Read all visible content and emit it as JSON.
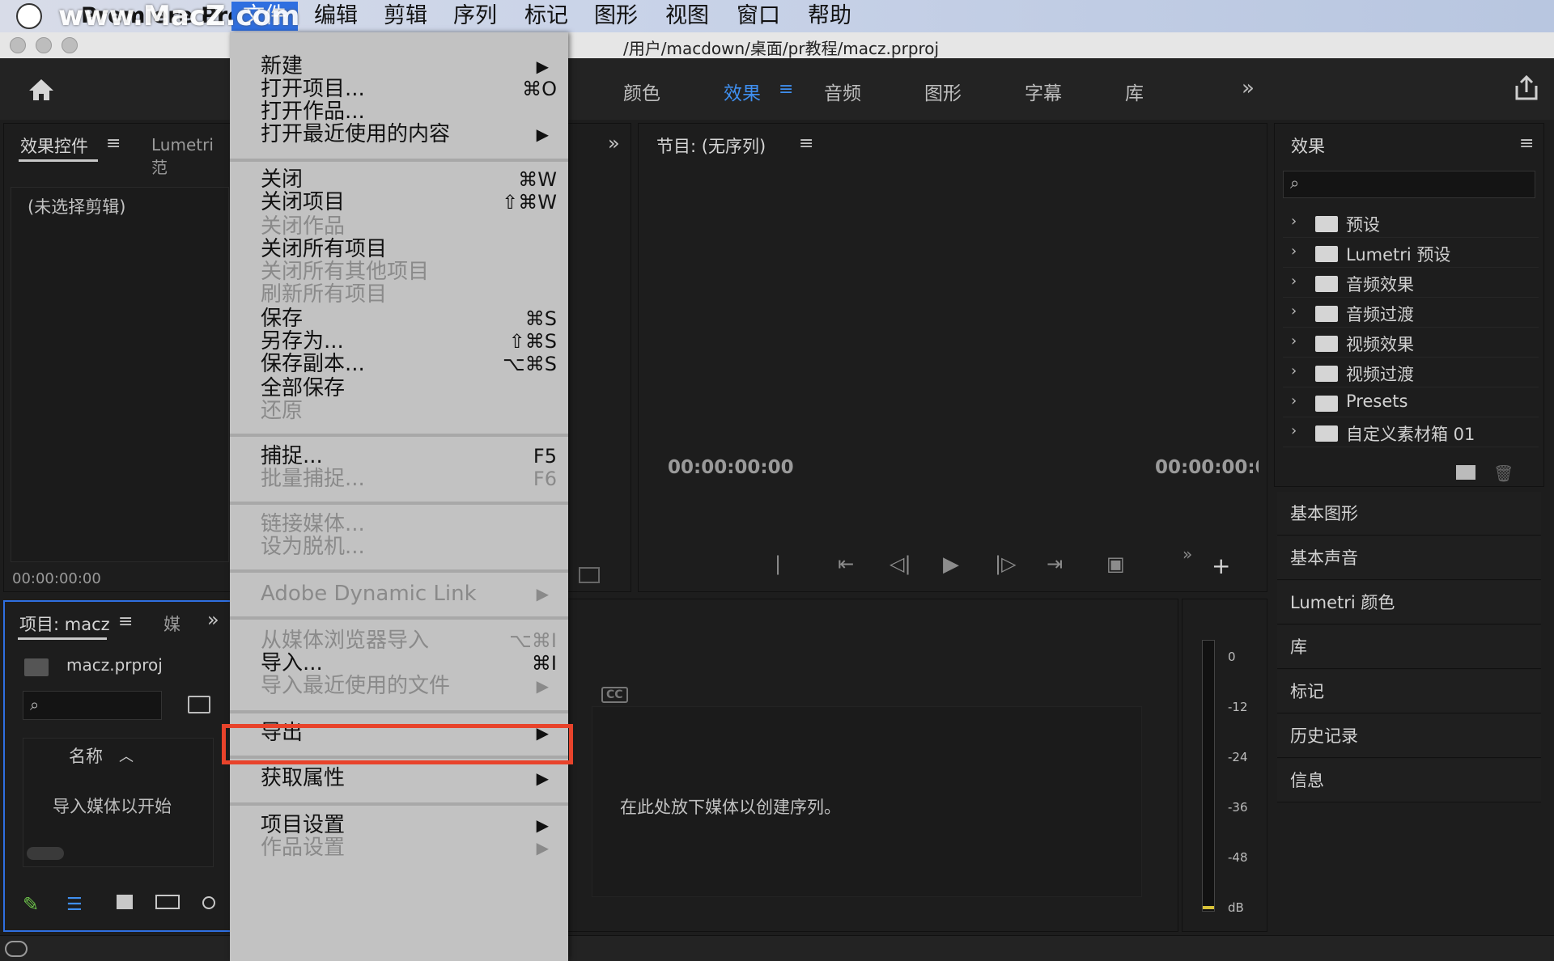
{
  "menubar": {
    "app_name": "Premiere Pro",
    "watermark": "www.MacZ.com",
    "items": [
      "文件",
      "编辑",
      "剪辑",
      "序列",
      "标记",
      "图形",
      "视图",
      "窗口",
      "帮助"
    ]
  },
  "window": {
    "title_path": "/用户/macdown/桌面/pr教程/macz.prproj"
  },
  "workspaces": {
    "tabs": [
      "颜色",
      "效果",
      "音频",
      "图形",
      "字幕",
      "库"
    ],
    "active": "效果"
  },
  "effect_controls": {
    "tab": "效果控件",
    "tab2": "Lumetri 范",
    "no_clip": "(未选择剪辑)",
    "timecode": "00:00:00:00"
  },
  "project": {
    "tab": "项目: macz",
    "tab2": "媒",
    "file": "macz.prproj",
    "col_name": "名称",
    "empty_msg": "导入媒体以开始"
  },
  "program": {
    "title": "节目: (无序列)",
    "tc_left": "00:00:00:00",
    "tc_right": "00:00:00:0"
  },
  "timeline": {
    "drop_msg": "在此处放下媒体以创建序列。",
    "cc": "CC"
  },
  "audio_meter": {
    "ticks": [
      "0",
      "-12",
      "-24",
      "-36",
      "-48",
      "dB"
    ]
  },
  "effects_panel": {
    "title": "效果",
    "items": [
      "预设",
      "Lumetri 预设",
      "音频效果",
      "音频过渡",
      "视频效果",
      "视频过渡",
      "Presets",
      "自定义素材箱 01"
    ]
  },
  "side_panels": [
    "基本图形",
    "基本声音",
    "Lumetri 颜色",
    "库",
    "标记",
    "历史记录",
    "信息"
  ],
  "file_menu": {
    "items": [
      {
        "label": "新建",
        "shortcut": "",
        "submenu": true,
        "disabled": false
      },
      {
        "label": "打开项目...",
        "shortcut": "⌘O",
        "submenu": false,
        "disabled": false
      },
      {
        "label": "打开作品...",
        "shortcut": "",
        "submenu": false,
        "disabled": false
      },
      {
        "label": "打开最近使用的内容",
        "shortcut": "",
        "submenu": true,
        "disabled": false
      },
      {
        "label": "关闭",
        "shortcut": "⌘W",
        "submenu": false,
        "disabled": false
      },
      {
        "label": "关闭项目",
        "shortcut": "⇧⌘W",
        "submenu": false,
        "disabled": false
      },
      {
        "label": "关闭作品",
        "shortcut": "",
        "submenu": false,
        "disabled": true
      },
      {
        "label": "关闭所有项目",
        "shortcut": "",
        "submenu": false,
        "disabled": false
      },
      {
        "label": "关闭所有其他项目",
        "shortcut": "",
        "submenu": false,
        "disabled": true
      },
      {
        "label": "刷新所有项目",
        "shortcut": "",
        "submenu": false,
        "disabled": true
      },
      {
        "label": "保存",
        "shortcut": "⌘S",
        "submenu": false,
        "disabled": false
      },
      {
        "label": "另存为...",
        "shortcut": "⇧⌘S",
        "submenu": false,
        "disabled": false
      },
      {
        "label": "保存副本...",
        "shortcut": "⌥⌘S",
        "submenu": false,
        "disabled": false
      },
      {
        "label": "全部保存",
        "shortcut": "",
        "submenu": false,
        "disabled": false
      },
      {
        "label": "还原",
        "shortcut": "",
        "submenu": false,
        "disabled": true
      },
      {
        "label": "捕捉...",
        "shortcut": "F5",
        "submenu": false,
        "disabled": false
      },
      {
        "label": "批量捕捉...",
        "shortcut": "F6",
        "submenu": false,
        "disabled": true
      },
      {
        "label": "链接媒体...",
        "shortcut": "",
        "submenu": false,
        "disabled": true
      },
      {
        "label": "设为脱机...",
        "shortcut": "",
        "submenu": false,
        "disabled": true
      },
      {
        "label": "Adobe Dynamic Link",
        "shortcut": "",
        "submenu": true,
        "disabled": true
      },
      {
        "label": "从媒体浏览器导入",
        "shortcut": "⌥⌘I",
        "submenu": false,
        "disabled": true
      },
      {
        "label": "导入...",
        "shortcut": "⌘I",
        "submenu": false,
        "disabled": false
      },
      {
        "label": "导入最近使用的文件",
        "shortcut": "",
        "submenu": true,
        "disabled": true
      },
      {
        "label": "导出",
        "shortcut": "",
        "submenu": true,
        "disabled": false
      },
      {
        "label": "获取属性",
        "shortcut": "",
        "submenu": true,
        "disabled": false
      },
      {
        "label": "项目设置",
        "shortcut": "",
        "submenu": true,
        "disabled": false
      },
      {
        "label": "作品设置",
        "shortcut": "",
        "submenu": true,
        "disabled": true
      }
    ]
  }
}
